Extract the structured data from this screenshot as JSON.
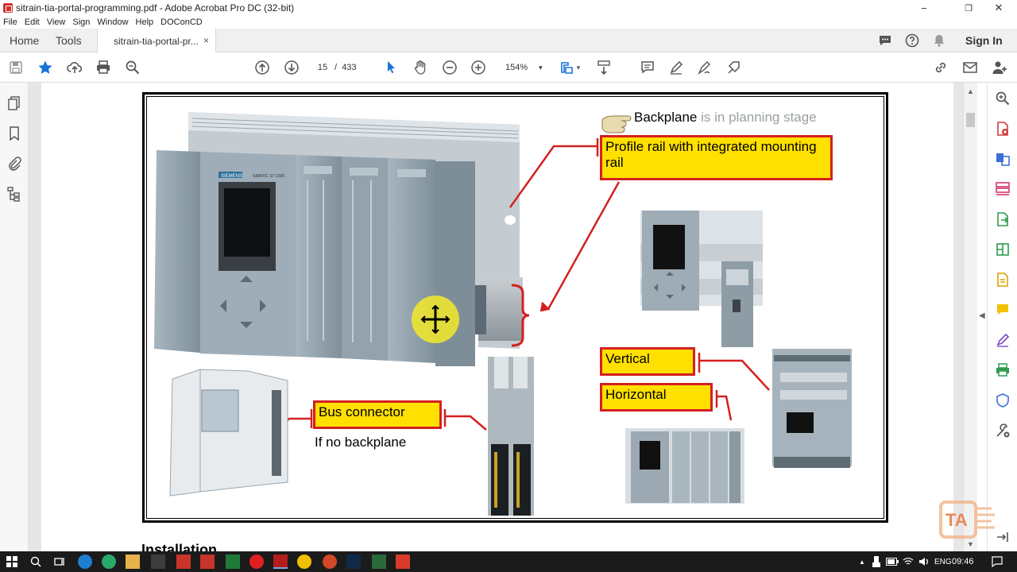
{
  "window": {
    "title": "sitrain-tia-portal-programming.pdf - Adobe Acrobat Pro DC (32-bit)",
    "minimize": "−",
    "maximize": "❐",
    "close": "✕"
  },
  "menu": {
    "items": [
      "File",
      "Edit",
      "View",
      "Sign",
      "Window",
      "Help",
      "DOConCD"
    ]
  },
  "tabs": {
    "home": "Home",
    "tools": "Tools",
    "document": "sitrain-tia-portal-pr...",
    "close": "×",
    "sign_in": "Sign In"
  },
  "toolbar": {
    "current_page": "15",
    "page_separator": "/",
    "total_pages": "433",
    "zoom": "154%",
    "zoom_caret": "▾"
  },
  "slide": {
    "callout_title_bold": "Backplane",
    "callout_title_rest": " is in planning stage",
    "profile_rail": "Profile rail with integrated mounting rail",
    "bus_connector": "Bus connector",
    "no_backplane": "If no backplane",
    "vertical": "Vertical",
    "horizontal": "Horizontal",
    "plc_brand": "SIEMENS",
    "plc_model": "SIMATIC S7-1500"
  },
  "document": {
    "next_heading": "Installation"
  },
  "watermark": {
    "text": "TA"
  },
  "taskbar": {
    "language": "ENG",
    "time": "09:46"
  },
  "colors": {
    "label_fill": "#ffe000",
    "label_border": "#d42020",
    "module_gray": "#8a9aa6",
    "taskbar_bg": "#1b1b1b"
  }
}
